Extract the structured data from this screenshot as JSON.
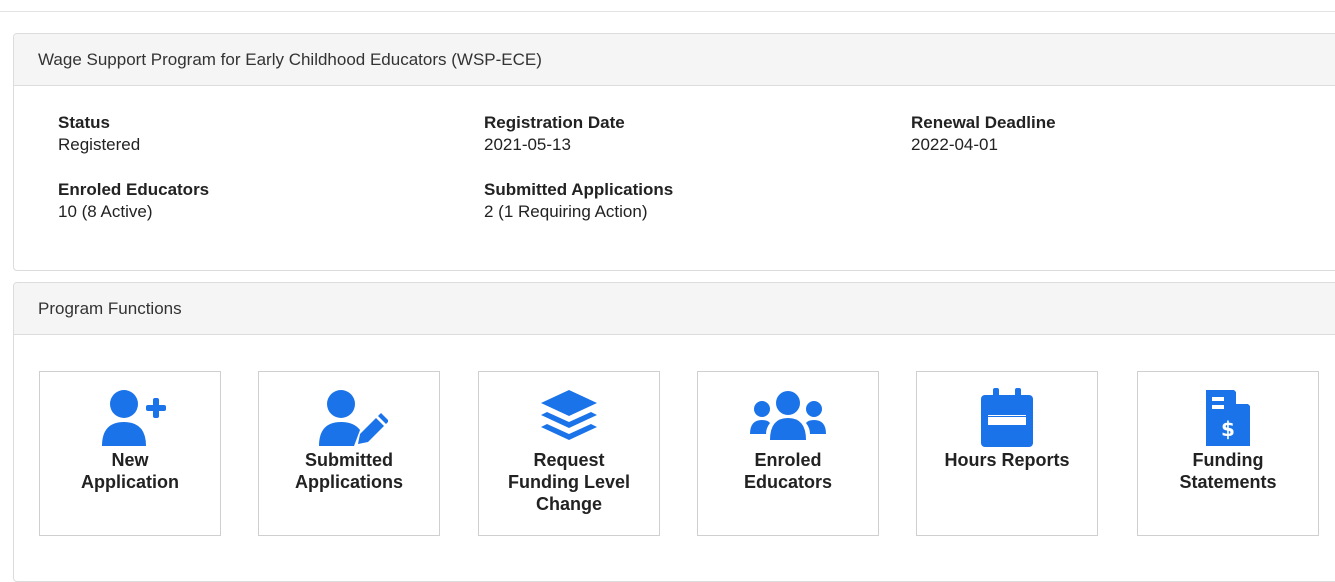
{
  "wsp": {
    "title": "Wage Support Program for Early Childhood Educators (WSP-ECE)",
    "status_label": "Status",
    "status_value": "Registered",
    "registration_label": "Registration Date",
    "registration_value": "2021-05-13",
    "renewal_label": "Renewal Deadline",
    "renewal_value": "2022-04-01",
    "enroled_label": "Enroled Educators",
    "enroled_value": "10 (8 Active)",
    "submitted_label": "Submitted Applications",
    "submitted_value": "2 (1 Requiring Action)"
  },
  "functions": {
    "title": "Program Functions",
    "tiles": [
      {
        "label_1": "New",
        "label_2": "Application",
        "icon": "user-plus-icon"
      },
      {
        "label_1": "Submitted",
        "label_2": "Applications",
        "icon": "user-edit-icon"
      },
      {
        "label_1": "Request",
        "label_2": "Funding Level",
        "label_3": "Change",
        "icon": "layers-icon"
      },
      {
        "label_1": "Enroled",
        "label_2": "Educators",
        "icon": "users-icon"
      },
      {
        "label_1": "Hours Reports",
        "icon": "calendar-icon"
      },
      {
        "label_1": "Funding",
        "label_2": "Statements",
        "icon": "file-invoice-dollar-icon"
      }
    ]
  },
  "colors": {
    "accent": "#1a73e8",
    "panel_heading_bg": "#f5f5f5",
    "border": "#dcdcdc"
  }
}
